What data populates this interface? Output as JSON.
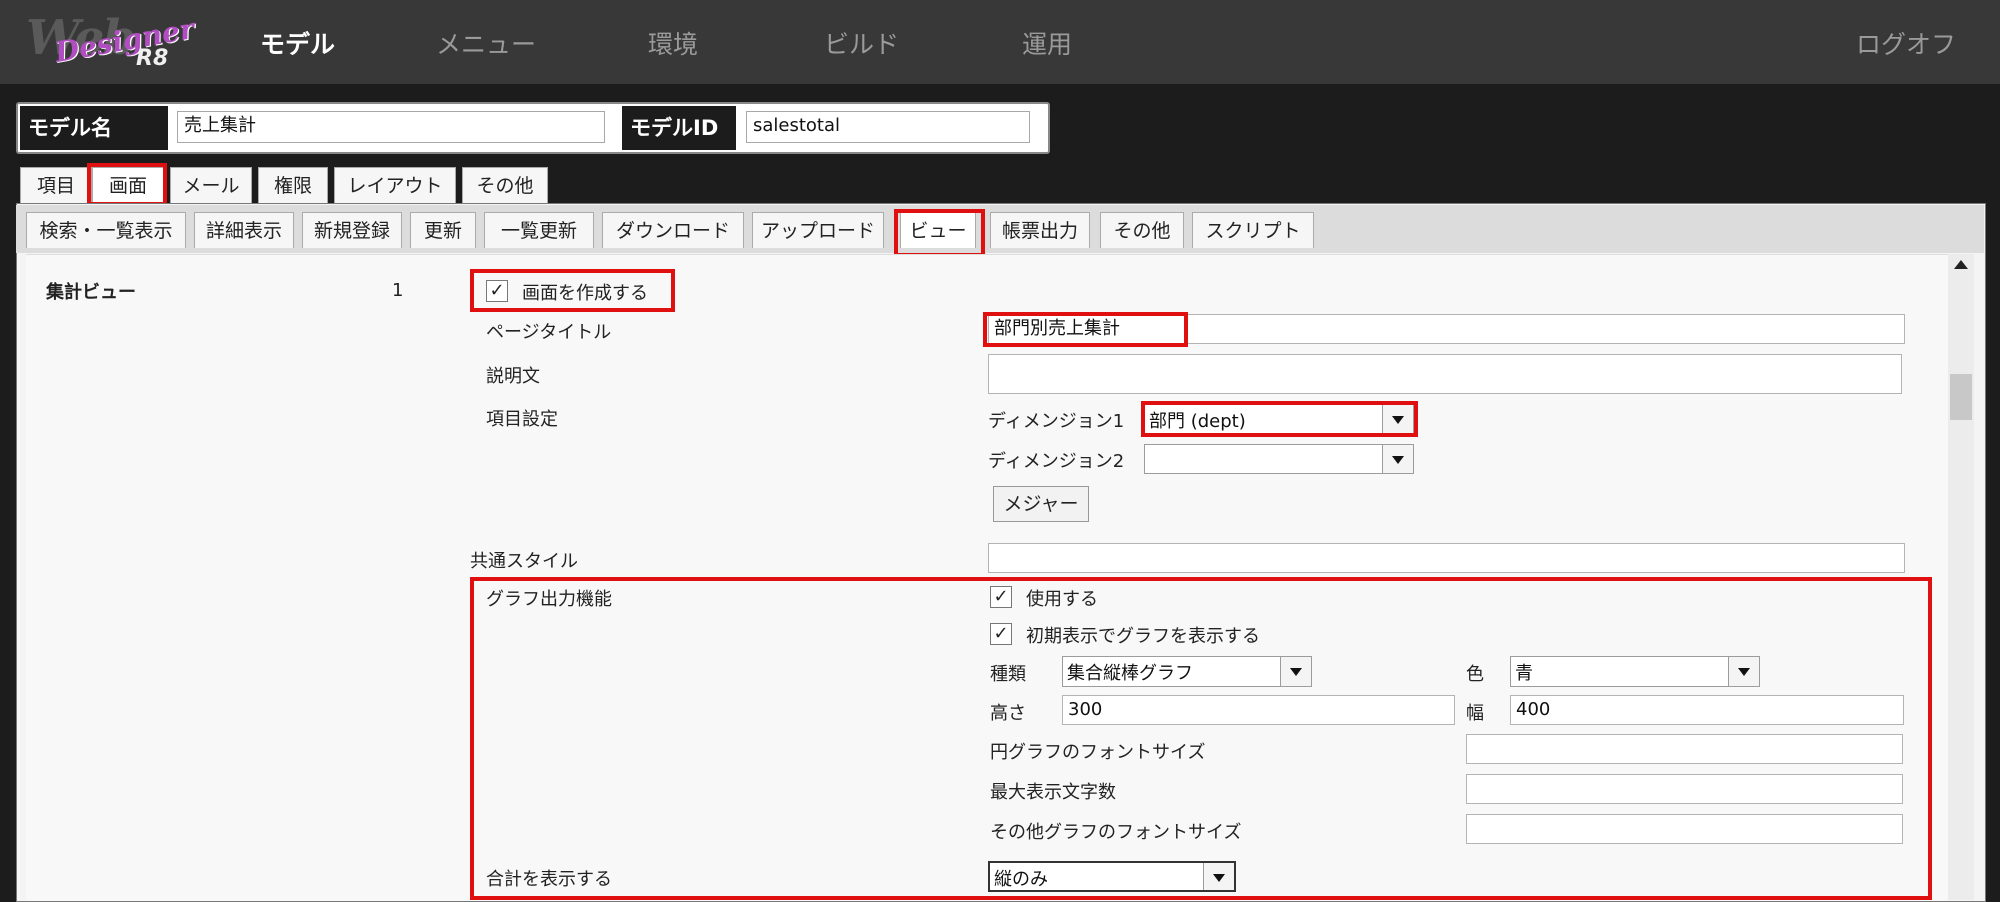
{
  "header": {
    "logo": {
      "word": "Web",
      "script": "Designer",
      "version": "R8"
    },
    "nav": [
      "モデル",
      "メニュー",
      "環境",
      "ビルド",
      "運用"
    ],
    "logoff": "ログオフ"
  },
  "model": {
    "name_label": "モデル名",
    "name_value": "売上集計",
    "id_label": "モデルID",
    "id_value": "salestotal"
  },
  "tabs": [
    "項目",
    "画面",
    "メール",
    "権限",
    "レイアウト",
    "その他"
  ],
  "subtabs": [
    "検索・一覧表示",
    "詳細表示",
    "新規登録",
    "更新",
    "一覧更新",
    "ダウンロード",
    "アップロード",
    "ビュー",
    "帳票出力",
    "その他",
    "スクリプト"
  ],
  "view": {
    "section_label": "集計ビュー",
    "index": "1",
    "create_screen": "画面を作成する",
    "page_title_label": "ページタイトル",
    "page_title_value": "部門別売上集計",
    "description_label": "説明文",
    "description_value": "",
    "item_settings_label": "項目設定",
    "dimension1_label": "ディメンジョン1",
    "dimension1_value": "部門 (dept)",
    "dimension2_label": "ディメンジョン2",
    "dimension2_value": "",
    "measure_button": "メジャー",
    "common_style_label": "共通スタイル",
    "common_style_value": "",
    "graph_label": "グラフ出力機能",
    "use_label": "使用する",
    "initial_graph_label": "初期表示でグラフを表示する",
    "type_label": "種類",
    "type_value": "集合縦棒グラフ",
    "color_label": "色",
    "color_value": "青",
    "height_label": "高さ",
    "height_value": "300",
    "width_label": "幅",
    "width_value": "400",
    "pie_font_label": "円グラフのフォントサイズ",
    "pie_font_value": "",
    "max_chars_label": "最大表示文字数",
    "max_chars_value": "",
    "other_font_label": "その他グラフのフォントサイズ",
    "other_font_value": "",
    "total_label": "合計を表示する",
    "total_value": "縦のみ",
    "check_mark": "✓"
  },
  "colors": {
    "highlight": "#e01010",
    "header_bg": "#383838",
    "page_bg": "#1c1c1c"
  }
}
